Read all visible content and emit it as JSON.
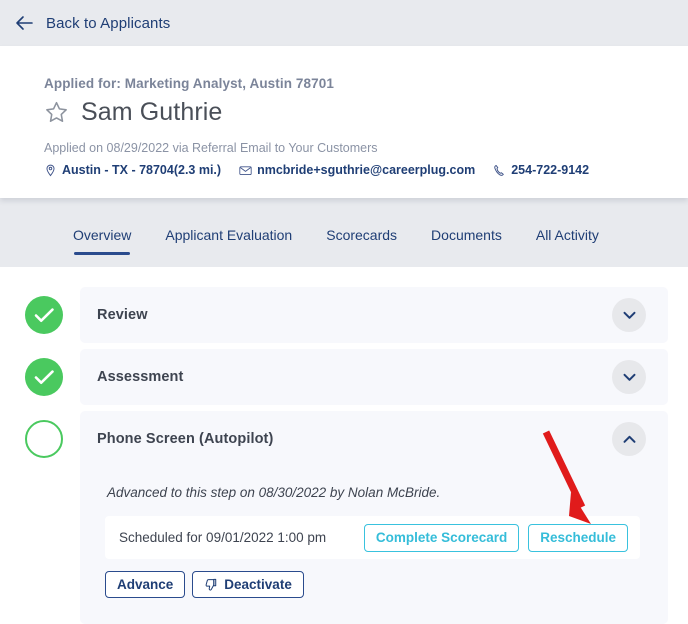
{
  "topbar": {
    "back_label": "Back to Applicants",
    "back_icon": "arrow-left-icon"
  },
  "header": {
    "applied_for": "Applied for: Marketing Analyst, Austin 78701",
    "star_icon": "star-outline-icon",
    "applicant_name": "Sam Guthrie",
    "applied_on": "Applied on 08/29/2022 via Referral Email to Your Customers",
    "contacts": [
      {
        "icon": "map-pin-icon",
        "text": "Austin - TX - 78704(2.3 mi.)"
      },
      {
        "icon": "envelope-icon",
        "text": "nmcbride+sguthrie@careerplug.com"
      },
      {
        "icon": "phone-icon",
        "text": "254-722-9142"
      }
    ]
  },
  "tabs": [
    {
      "label": "Overview",
      "active": true
    },
    {
      "label": "Applicant Evaluation",
      "active": false
    },
    {
      "label": "Scorecards",
      "active": false
    },
    {
      "label": "Documents",
      "active": false
    },
    {
      "label": "All Activity",
      "active": false
    }
  ],
  "steps": [
    {
      "title": "Review",
      "state": "done",
      "chevron": "chevron-down-icon"
    },
    {
      "title": "Assessment",
      "state": "done",
      "chevron": "chevron-down-icon"
    },
    {
      "title": "Phone Screen (Autopilot)",
      "state": "open",
      "chevron": "chevron-up-icon"
    }
  ],
  "phone_screen": {
    "advanced_note": "Advanced to this step on 08/30/2022 by Nolan McBride.",
    "scheduled_text": "Scheduled for 09/01/2022 1:00 pm",
    "complete_scorecard_label": "Complete Scorecard",
    "reschedule_label": "Reschedule",
    "advance_label": "Advance",
    "deactivate_label": "Deactivate",
    "deactivate_icon": "thumbs-down-icon"
  },
  "annotation": {
    "type": "arrow",
    "color": "#e01b1b",
    "points_to": "Reschedule"
  },
  "colors": {
    "topbar_bg": "#e8eaee",
    "card_bg": "#f7f8fc",
    "navy": "#1f3e75",
    "teal": "#39c2de",
    "green": "#4ac95f",
    "annotation_red": "#e01b1b"
  }
}
